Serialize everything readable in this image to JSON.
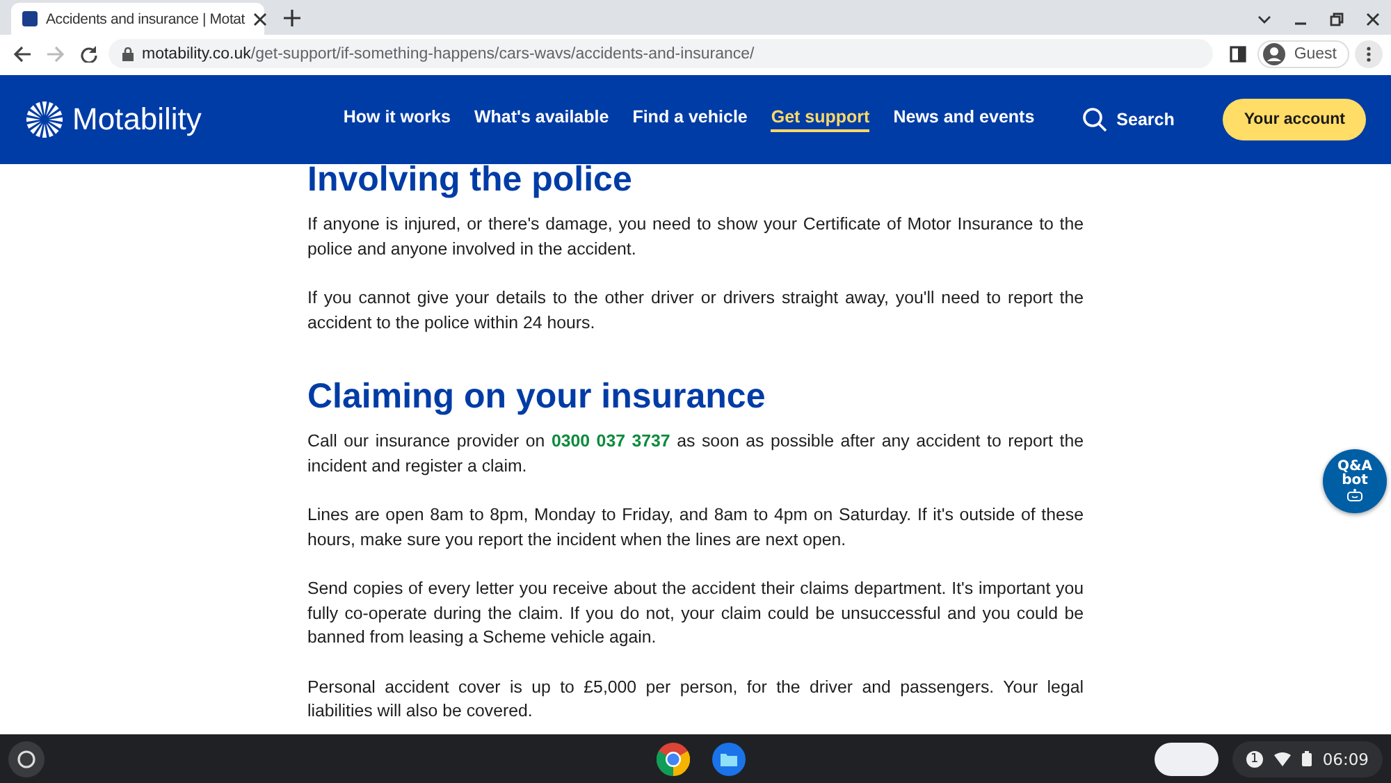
{
  "browser": {
    "tab": {
      "title": "Accidents and insurance | Motat",
      "selected": true
    },
    "url_host": "motability.co.uk",
    "url_path": "/get-support/if-something-happens/cars-wavs/accidents-and-insurance/",
    "profile": "Guest"
  },
  "site": {
    "logo": "Motability",
    "nav": [
      {
        "label": "How it works",
        "selected": false
      },
      {
        "label": "What's available",
        "selected": false
      },
      {
        "label": "Find a vehicle",
        "selected": false
      },
      {
        "label": "Get support",
        "selected": true
      },
      {
        "label": "News and events",
        "selected": false
      }
    ],
    "search": "Search",
    "account": "Your account"
  },
  "sections": [
    {
      "heading": "Involving the police",
      "paragraphs": [
        "If anyone is injured, or there's damage, you need to show your Certificate of Motor Insurance to the police and anyone involved in the accident.",
        "If you cannot give your details to the other driver or drivers straight away, you'll need to report the accident to the police within 24 hours."
      ]
    },
    {
      "heading": "Claiming on your insurance",
      "paragraphs": [
        "Call our insurance provider on **0300 037 3737** as soon as possible after any accident to report the incident and register a claim.",
        "Lines are open 8am to 8pm, Monday to Friday, and 8am to 4pm on Saturday. If it's outside of these hours, make sure you report the incident when the lines are next open.",
        "Send copies of every letter you receive about the accident their claims department. It's important you fully co-operate during the claim. If you do not, your claim could be unsuccessful and you could be banned from leasing a Scheme vehicle again.",
        "Personal accident cover is up to £5,000 per person, for the driver and passengers. Your legal liabilities will also be covered."
      ]
    }
  ],
  "bot": {
    "line_1": "Q&A",
    "line_2": "bot"
  },
  "shelf": {
    "notifications": "1",
    "time": "06:09"
  }
}
